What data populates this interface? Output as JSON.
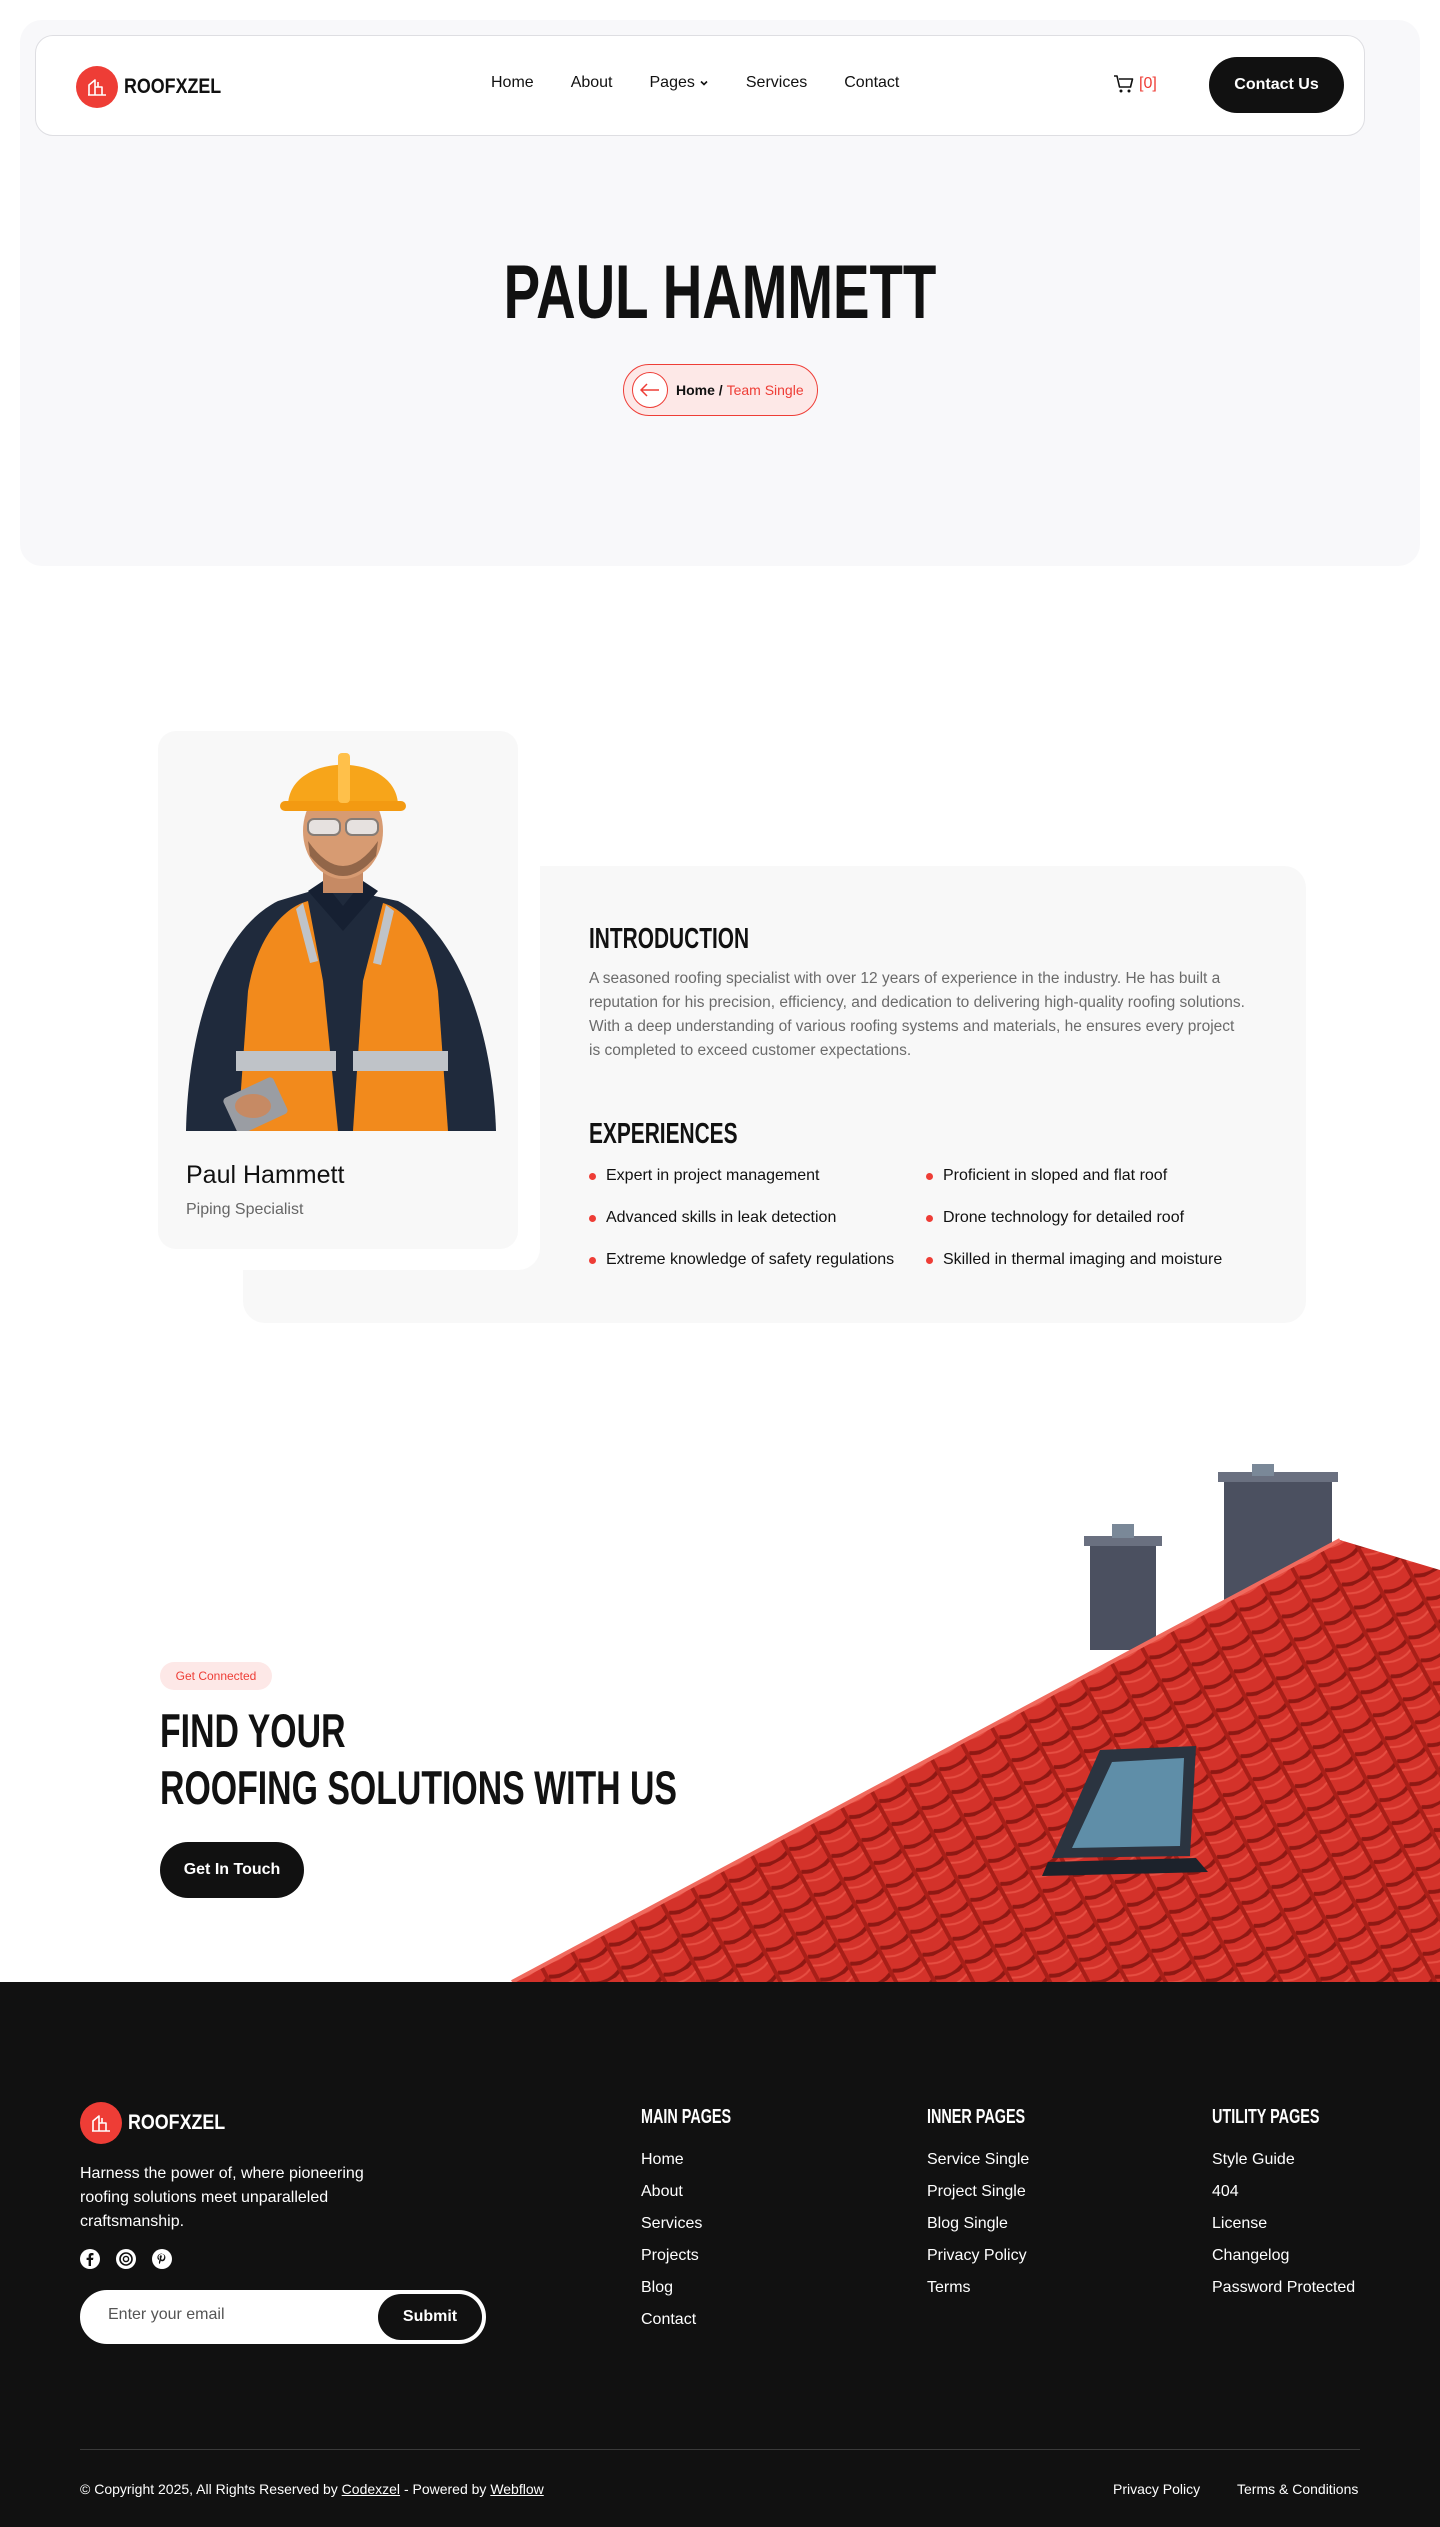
{
  "brand": {
    "name": "ROOFXZEL",
    "accent": "#ee3d36",
    "dark": "#111111"
  },
  "nav": {
    "links": [
      "Home",
      "About",
      "Pages",
      "Services",
      "Contact"
    ],
    "cart_count": "[0]",
    "cta": "Contact Us"
  },
  "hero": {
    "title": "PAUL HAMMETT",
    "breadcrumb_home": "Home /",
    "breadcrumb_current": "Team Single"
  },
  "profile": {
    "name": "Paul Hammett",
    "role": "Piping Specialist"
  },
  "introduction": {
    "heading": "INTRODUCTION",
    "text": "A seasoned roofing specialist with over 12 years of experience in the industry. He has built a reputation for his precision, efficiency, and dedication to delivering high-quality roofing solutions. With a deep understanding of various roofing systems and materials, he ensures every project is completed to exceed customer expectations."
  },
  "experiences": {
    "heading": "EXPERIENCES",
    "items": [
      "Expert in project management",
      "Proficient in sloped and flat roof",
      "Advanced skills in leak detection",
      "Drone technology for detailed roof",
      "Extreme knowledge of safety regulations",
      "Skilled in thermal imaging and moisture"
    ]
  },
  "cta": {
    "tag": "Get Connected",
    "title_line1": "FIND YOUR",
    "title_line2": "ROOFING SOLUTIONS WITH US",
    "button": "Get In Touch"
  },
  "footer": {
    "about": "Harness the power of, where pioneering roofing solutions meet unparalleled craftsmanship.",
    "socials": [
      "facebook-icon",
      "dribbble-icon",
      "pinterest-icon"
    ],
    "email_placeholder": "Enter your email",
    "submit": "Submit",
    "columns": [
      {
        "title": "MAIN PAGES",
        "links": [
          "Home",
          "About",
          "Services",
          "Projects",
          "Blog",
          "Contact"
        ]
      },
      {
        "title": "INNER PAGES",
        "links": [
          "Service Single",
          "Project Single",
          "Blog Single",
          "Privacy Policy",
          "Terms"
        ]
      },
      {
        "title": "UTILITY PAGES",
        "links": [
          "Style Guide",
          "404",
          "License",
          "Changelog",
          "Password Protected"
        ]
      }
    ],
    "copyright_prefix": "© Copyright 2025, All Rights Reserved by",
    "copyright_link": "Codexzel",
    "copyright_mid": "- Powered by",
    "copyright_link2": "Webflow",
    "legal": [
      "Privacy Policy",
      "Terms & Conditions"
    ]
  }
}
